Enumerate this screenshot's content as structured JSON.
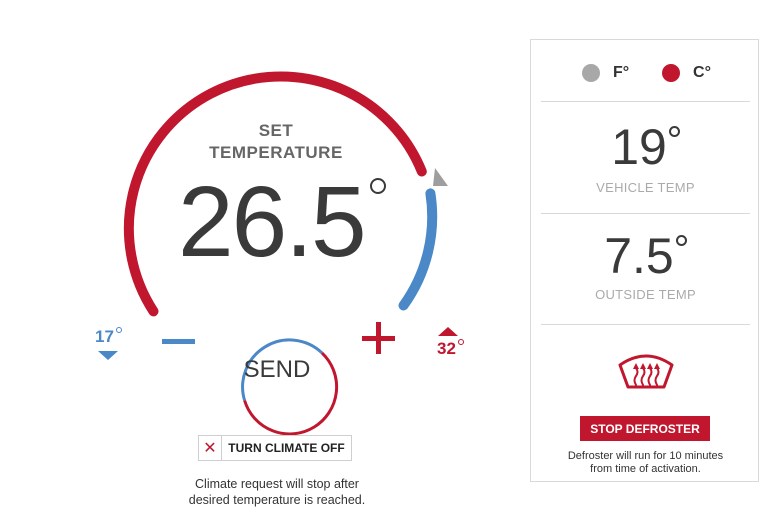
{
  "dial": {
    "label_line1": "SET",
    "label_line2": "TEMPERATURE",
    "set_temp": "26.5",
    "min_temp": "17",
    "max_temp": "32",
    "send_label": "SEND",
    "colors": {
      "heat": "#c0172f",
      "cool": "#4a88c8",
      "marker": "#9e9e9e"
    }
  },
  "climate": {
    "off_icon": "close-icon",
    "off_label": "TURN CLIMATE OFF",
    "note_line1": "Climate request will stop after",
    "note_line2": "desired temperature is reached."
  },
  "units": {
    "f_label": "F",
    "c_label": "C",
    "selected": "C"
  },
  "vehicle": {
    "temp": "19",
    "label": "VEHICLE TEMP"
  },
  "outside": {
    "temp": "7.5",
    "label": "OUTSIDE TEMP"
  },
  "defroster": {
    "icon": "rear-defrost-icon",
    "button_label": "STOP DEFROSTER",
    "note_line1": "Defroster will run for 10 minutes",
    "note_line2": "from time of activation."
  }
}
